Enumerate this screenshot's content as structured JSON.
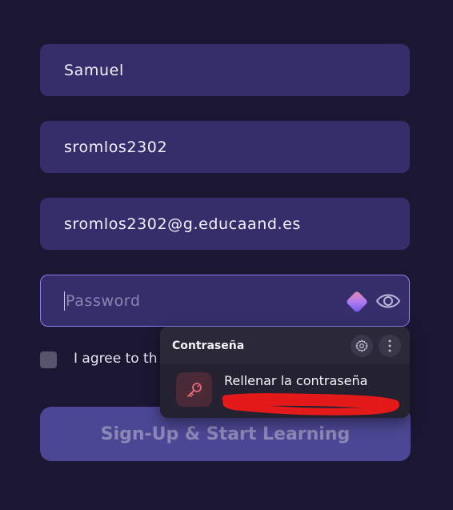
{
  "form": {
    "name_value": "Samuel",
    "username_value": "sromlos2302",
    "email_value": "sromlos2302@g.educaand.es",
    "password_placeholder": "Password",
    "agree_text": "I agree to th",
    "submit_label": "Sign-Up & Start Learning"
  },
  "password_popup": {
    "title": "Contraseña",
    "fill_label": "Rellenar la contraseña"
  },
  "icons": {
    "password_manager": "password-manager-icon",
    "show_password": "eye-icon",
    "settings": "gear-icon",
    "more": "more-vertical-icon",
    "key": "key-icon"
  },
  "colors": {
    "background": "#1b1733",
    "field": "#342f6b",
    "button": "#4c4794",
    "popup": "#242231",
    "key_accent": "#e46a7a",
    "redaction": "#e41a1a"
  }
}
